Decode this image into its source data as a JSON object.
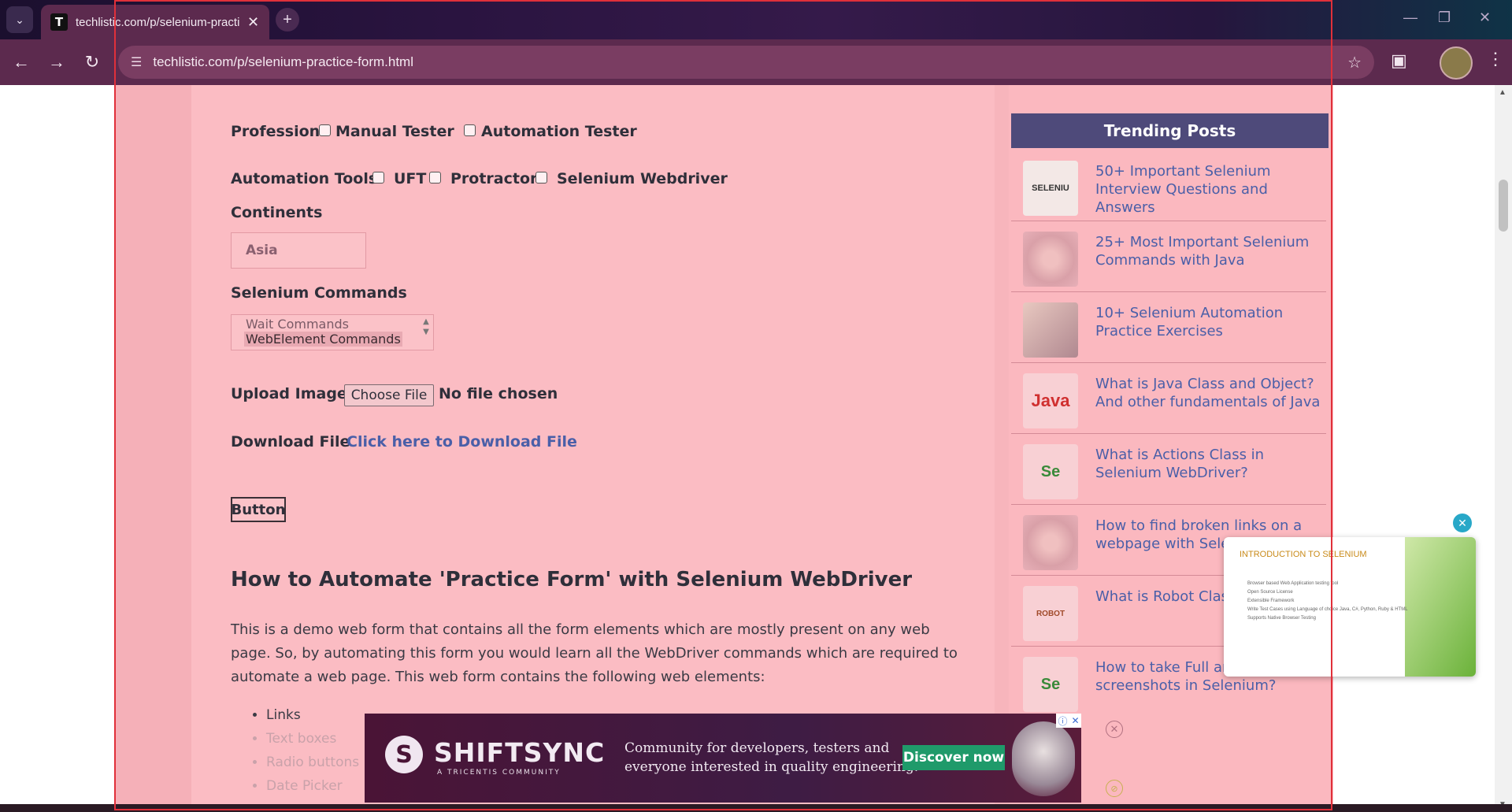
{
  "browser": {
    "tab_title": "techlistic.com/p/selenium-practi",
    "tab_favicon_letter": "T",
    "url": "techlistic.com/p/selenium-practice-form.html"
  },
  "form": {
    "profession_label": "Profession",
    "profession_options": [
      "Manual Tester",
      "Automation Tester"
    ],
    "tools_label": "Automation Tools",
    "tools_options": [
      "UFT",
      "Protractor",
      "Selenium Webdriver"
    ],
    "continents_label": "Continents",
    "continents_value": "Asia",
    "commands_label": "Selenium Commands",
    "commands_options": [
      "Wait Commands",
      "WebElement Commands"
    ],
    "upload_label": "Upload Image",
    "upload_button": "Choose File",
    "upload_status": "No file chosen",
    "download_label": "Download File",
    "download_link": "Click here to Download File",
    "button_label": "Button"
  },
  "article": {
    "heading": "How to Automate 'Practice Form' with Selenium WebDriver",
    "paragraph": "This is a demo web form that contains all the form elements which are mostly present on any web page. So, by automating this form you would learn all the WebDriver commands which are required to automate a web page. This web form contains the following web elements:",
    "bullets": [
      "Links",
      "Text boxes",
      "Radio buttons",
      "Date Picker"
    ]
  },
  "sidebar": {
    "heading": "Trending Posts",
    "posts": [
      {
        "title": "50+ Important Selenium Interview Questions and Answers",
        "thumb": "SELENIU"
      },
      {
        "title": "25+ Most Important Selenium Commands with Java",
        "thumb": ""
      },
      {
        "title": "10+ Selenium Automation Practice Exercises",
        "thumb": ""
      },
      {
        "title": "What is Java Class and Object? And other fundamentals of Java",
        "thumb": "Java"
      },
      {
        "title": "What is Actions Class in Selenium WebDriver?",
        "thumb": "Se"
      },
      {
        "title": "How to find broken links on a webpage with Seler",
        "thumb": ""
      },
      {
        "title": "What is Robot Class WebDriver?",
        "thumb": "ROBOT"
      },
      {
        "title": "How to take Full and Partial screenshots in Selenium?",
        "thumb": "Se"
      }
    ]
  },
  "video_popup": {
    "title": "INTRODUCTION TO SELENIUM",
    "lines": [
      "Browser based Web Application testing tool",
      "Open Source License",
      "Extensible Framework",
      "Write Test Cases using Language of choice Java, C#, Python, Ruby & HTML",
      "Supports Native Browser Testing"
    ]
  },
  "ad": {
    "brand": "SHIFTSYNC",
    "sub": "A TRICENTIS COMMUNITY",
    "tagline_1": "Community for developers, testers and",
    "tagline_2": "everyone interested in quality engineering.",
    "cta": "Discover now"
  },
  "colors": {
    "overlay_pink": "#fbb8bf",
    "trending_header": "#4e4a7a",
    "link_blue": "#4a5fa8",
    "frame_red": "#e0303a"
  }
}
